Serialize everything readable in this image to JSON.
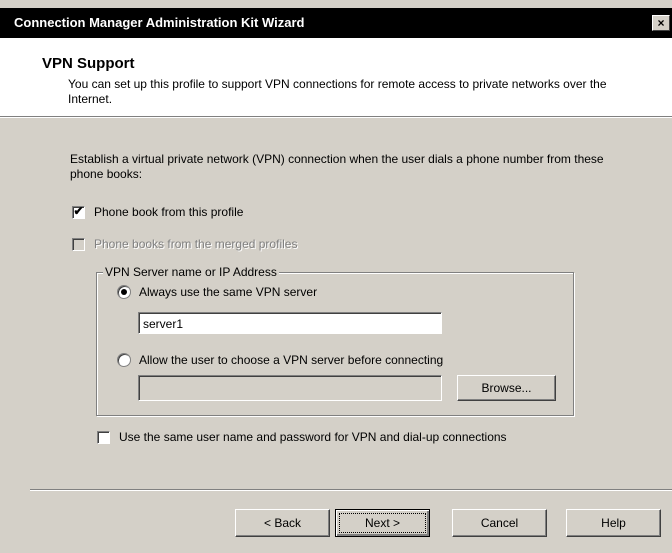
{
  "window": {
    "title": "Connection Manager Administration Kit Wizard",
    "close_glyph": "×"
  },
  "header": {
    "title": "VPN Support",
    "subtitle": "You can set up this profile to support VPN connections for remote access to private networks over the Internet."
  },
  "instruction": "Establish a virtual private network (VPN) connection when the user dials a phone number from these phone books:",
  "options": {
    "phonebook_profile": {
      "label": "Phone book from this profile",
      "checked": true
    },
    "phonebook_merged": {
      "label": "Phone books from the merged profiles",
      "checked": false,
      "enabled": false
    },
    "same_credentials": {
      "label": "Use the same user name and password for VPN and dial-up connections",
      "checked": false
    }
  },
  "vpn_group": {
    "label": "VPN Server name or IP Address",
    "always_same": {
      "label": "Always use the same VPN server",
      "selected": true
    },
    "server_value": "server1",
    "allow_choose": {
      "label": "Allow the user to choose a VPN server before connecting",
      "selected": false
    },
    "file_value": "",
    "browse_label": "Browse..."
  },
  "buttons": {
    "back": "< Back",
    "next": "Next >",
    "cancel": "Cancel",
    "help": "Help"
  }
}
